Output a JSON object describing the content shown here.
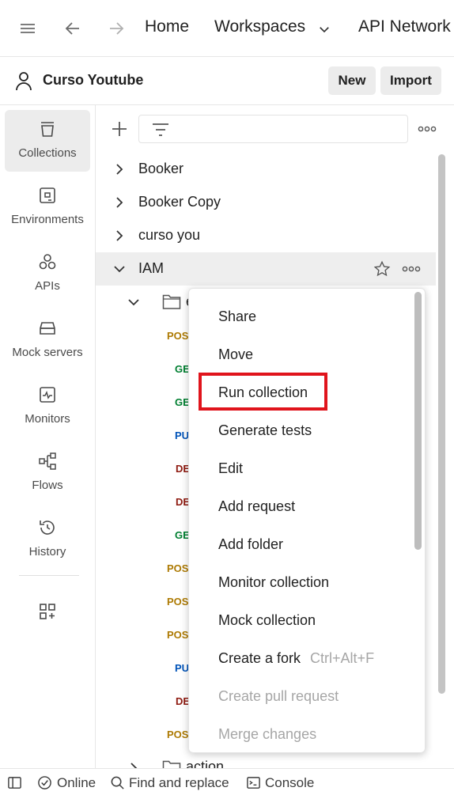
{
  "topbar": {
    "home": "Home",
    "workspaces": "Workspaces",
    "api_network": "API Network",
    "icons": [
      "menu-icon",
      "back-arrow-icon",
      "forward-arrow-icon",
      "chevron-down-icon"
    ]
  },
  "workspace": {
    "name": "Curso Youtube",
    "new_label": "New",
    "import_label": "Import"
  },
  "sidebar": {
    "items": [
      {
        "label": "Collections",
        "icon": "collections-icon",
        "active": true
      },
      {
        "label": "Environments",
        "icon": "environments-icon"
      },
      {
        "label": "APIs",
        "icon": "apis-icon"
      },
      {
        "label": "Mock servers",
        "icon": "mock-servers-icon"
      },
      {
        "label": "Monitors",
        "icon": "monitors-icon"
      },
      {
        "label": "Flows",
        "icon": "flows-icon"
      },
      {
        "label": "History",
        "icon": "history-icon"
      }
    ]
  },
  "collections": [
    {
      "name": "Booker",
      "expanded": false
    },
    {
      "name": "Booker Copy",
      "expanded": false
    },
    {
      "name": "curso you",
      "expanded": false
    },
    {
      "name": "IAM",
      "expanded": true,
      "selected": true
    }
  ],
  "iam_children": {
    "folder_partial": "e",
    "methods": [
      "POS",
      "GE",
      "GE",
      "PU",
      "DE",
      "DE",
      "GE",
      "POS",
      "POS",
      "POS",
      "PU",
      "DE",
      "POS"
    ],
    "last_folder": "action"
  },
  "context_menu": {
    "items": [
      {
        "label": "Share"
      },
      {
        "label": "Move"
      },
      {
        "label": "Run collection",
        "highlighted": true
      },
      {
        "label": "Generate tests"
      },
      {
        "label": "Edit"
      },
      {
        "label": "Add request"
      },
      {
        "label": "Add folder"
      },
      {
        "label": "Monitor collection"
      },
      {
        "label": "Mock collection"
      },
      {
        "label": "Create a fork",
        "shortcut": "Ctrl+Alt+F"
      },
      {
        "label": "Create pull request",
        "disabled": true
      },
      {
        "label": "Merge changes",
        "disabled": true
      }
    ]
  },
  "statusbar": {
    "online": "Online",
    "find_replace": "Find and replace",
    "console": "Console"
  },
  "colors": {
    "post": "#ad7a03",
    "get": "#007f31",
    "put": "#0053b8",
    "delete": "#8e1a10",
    "highlight": "#e0141c"
  }
}
